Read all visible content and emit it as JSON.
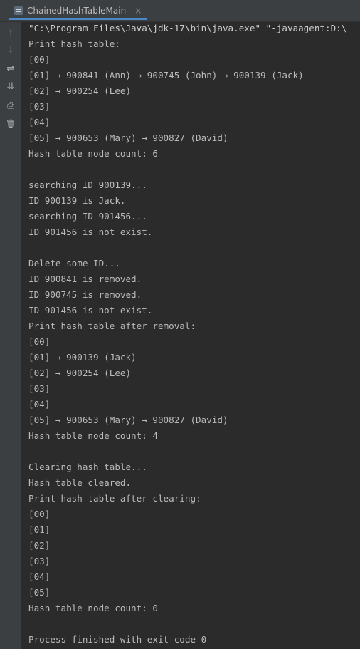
{
  "tab": {
    "title": "ChainedHashTableMain",
    "close_glyph": "×"
  },
  "toolbar": [
    {
      "name": "up-arrow-icon",
      "glyph": "↑"
    },
    {
      "name": "down-arrow-icon",
      "glyph": "↓"
    },
    {
      "name": "soft-wrap-icon",
      "glyph": "⇌"
    },
    {
      "name": "scroll-to-end-icon",
      "glyph": "⇊"
    },
    {
      "name": "print-icon",
      "glyph": "⎙"
    },
    {
      "name": "trash-icon",
      "glyph": "🗑"
    }
  ],
  "console": {
    "lines": [
      "\"C:\\Program Files\\Java\\jdk-17\\bin\\java.exe\" \"-javaagent:D:\\",
      "Print hash table:",
      "[00]",
      "[01] → 900841 (Ann) → 900745 (John) → 900139 (Jack)",
      "[02] → 900254 (Lee)",
      "[03]",
      "[04]",
      "[05] → 900653 (Mary) → 900827 (David)",
      "Hash table node count: 6",
      "",
      "searching ID 900139...",
      "ID 900139 is Jack.",
      "searching ID 901456...",
      "ID 901456 is not exist.",
      "",
      "Delete some ID...",
      "ID 900841 is removed.",
      "ID 900745 is removed.",
      "ID 901456 is not exist.",
      "Print hash table after removal:",
      "[00]",
      "[01] → 900139 (Jack)",
      "[02] → 900254 (Lee)",
      "[03]",
      "[04]",
      "[05] → 900653 (Mary) → 900827 (David)",
      "Hash table node count: 4",
      "",
      "Clearing hash table...",
      "Hash table cleared.",
      "Print hash table after clearing:",
      "[00]",
      "[01]",
      "[02]",
      "[03]",
      "[04]",
      "[05]",
      "Hash table node count: 0",
      "",
      "Process finished with exit code 0"
    ]
  }
}
